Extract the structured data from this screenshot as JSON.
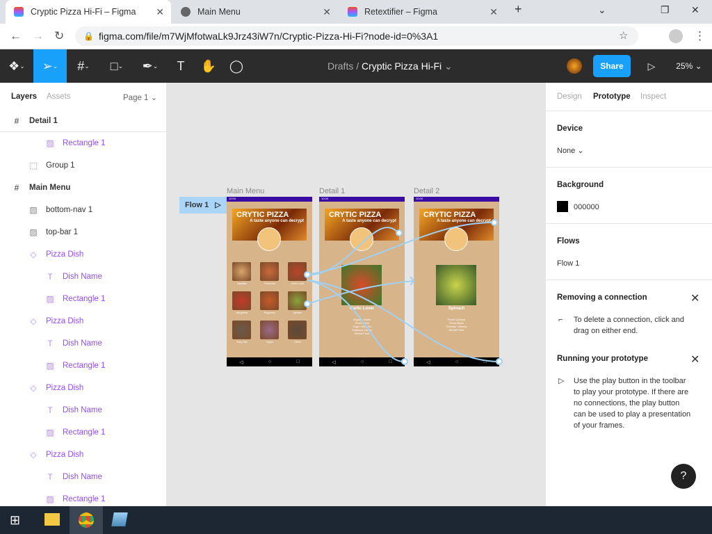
{
  "browser": {
    "tabs": [
      {
        "title": "Cryptic Pizza Hi-Fi – Figma"
      },
      {
        "title": "Main Menu"
      },
      {
        "title": "Retextifier – Figma"
      }
    ],
    "url": "figma.com/file/m7WjMfotwaLk9Jrz43iW7n/Cryptic-Pizza-Hi-Fi?node-id=0%3A1"
  },
  "toolbar": {
    "breadcrumb_parent": "Drafts",
    "file_name": "Cryptic Pizza Hi-Fi",
    "share_label": "Share",
    "zoom": "25%"
  },
  "left": {
    "tabs": {
      "layers": "Layers",
      "assets": "Assets",
      "page": "Page 1"
    },
    "layers": [
      {
        "label": "Detail 1",
        "type": "frame",
        "indent": 0
      },
      {
        "label": "Rectangle 1",
        "type": "image",
        "indent": 2
      },
      {
        "label": "Group 1",
        "type": "group",
        "indent": 1
      },
      {
        "label": "Main Menu",
        "type": "frame",
        "indent": 0
      },
      {
        "label": "bottom-nav 1",
        "type": "image",
        "indent": 1
      },
      {
        "label": "top-bar 1",
        "type": "image",
        "indent": 1
      },
      {
        "label": "Pizza Dish",
        "type": "component",
        "indent": 1
      },
      {
        "label": "Dish Name",
        "type": "text",
        "indent": 2
      },
      {
        "label": "Rectangle 1",
        "type": "image",
        "indent": 2
      },
      {
        "label": "Pizza Dish",
        "type": "component",
        "indent": 1
      },
      {
        "label": "Dish Name",
        "type": "text",
        "indent": 2
      },
      {
        "label": "Rectangle 1",
        "type": "image",
        "indent": 2
      },
      {
        "label": "Pizza Dish",
        "type": "component",
        "indent": 1
      },
      {
        "label": "Dish Name",
        "type": "text",
        "indent": 2
      },
      {
        "label": "Rectangle 1",
        "type": "image",
        "indent": 2
      },
      {
        "label": "Pizza Dish",
        "type": "component",
        "indent": 1
      },
      {
        "label": "Dish Name",
        "type": "text",
        "indent": 2
      },
      {
        "label": "Rectangle 1",
        "type": "image",
        "indent": 2
      }
    ]
  },
  "canvas": {
    "flow_label": "Flow 1",
    "frames": [
      {
        "name": "Main Menu"
      },
      {
        "name": "Detail 1"
      },
      {
        "name": "Detail 2"
      }
    ],
    "app": {
      "status_time": "10:00",
      "title": "CRYTIC PIZZA",
      "tagline": "A taste anyone can decrypt",
      "logo": "CRYPTIC PIZZA"
    },
    "dishes": [
      "Hawaiian",
      "Prosciutto",
      "Garlic Lover",
      "Margherita",
      "Pepperoni",
      "Spinach",
      "Easy Sea",
      "Vegan",
      "Olives"
    ],
    "detail1": {
      "name": "Garlic Lover",
      "ingredients": [
        "Organic Garlic",
        "Fresh Basil",
        "Virgin Olive Oil",
        "Marinara Sauce",
        "Wheat Flour"
      ]
    },
    "detail2": {
      "name": "Spinach",
      "ingredients": [
        "Fresh Spinach",
        "Fresh Basil",
        "Cheddar Cheese",
        "Wheat Flour"
      ]
    }
  },
  "right": {
    "tabs": {
      "design": "Design",
      "prototype": "Prototype",
      "inspect": "Inspect"
    },
    "device": {
      "title": "Device",
      "value": "None"
    },
    "background": {
      "title": "Background",
      "value": "000000",
      "color": "#000000"
    },
    "flows": {
      "title": "Flows",
      "value": "Flow 1"
    },
    "removing": {
      "title": "Removing a connection",
      "text": "To delete a connection, click and drag on either end."
    },
    "running": {
      "title": "Running your prototype",
      "text": "Use the play button in the toolbar to play your prototype. If there are no connections, the play button can be used to play a presentation of your frames."
    },
    "help": "?"
  }
}
